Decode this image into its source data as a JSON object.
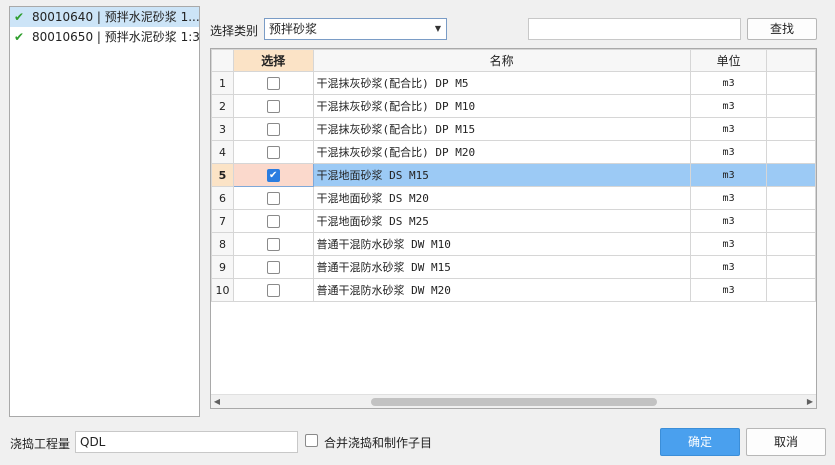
{
  "left_list": {
    "items": [
      {
        "label": "80010640 | 预拌水泥砂浆 1...",
        "selected": true
      },
      {
        "label": "80010650 | 预拌水泥砂浆 1:3",
        "selected": false
      }
    ]
  },
  "filter": {
    "category_label": "选择类别",
    "category_value": "预拌砂浆",
    "search_value": "",
    "search_button": "查找"
  },
  "grid": {
    "headers": {
      "select": "选择",
      "name": "名称",
      "unit": "单位"
    },
    "rows": [
      {
        "no": "1",
        "checked": false,
        "name": "干混抹灰砂浆(配合比) DP M5",
        "unit": "m3"
      },
      {
        "no": "2",
        "checked": false,
        "name": "干混抹灰砂浆(配合比) DP M10",
        "unit": "m3"
      },
      {
        "no": "3",
        "checked": false,
        "name": "干混抹灰砂浆(配合比) DP M15",
        "unit": "m3"
      },
      {
        "no": "4",
        "checked": false,
        "name": "干混抹灰砂浆(配合比) DP M20",
        "unit": "m3"
      },
      {
        "no": "5",
        "checked": true,
        "name": "干混地面砂浆 DS M15",
        "unit": "m3"
      },
      {
        "no": "6",
        "checked": false,
        "name": "干混地面砂浆 DS M20",
        "unit": "m3"
      },
      {
        "no": "7",
        "checked": false,
        "name": "干混地面砂浆 DS M25",
        "unit": "m3"
      },
      {
        "no": "8",
        "checked": false,
        "name": "普通干混防水砂浆 DW M10",
        "unit": "m3"
      },
      {
        "no": "9",
        "checked": false,
        "name": "普通干混防水砂浆 DW M15",
        "unit": "m3"
      },
      {
        "no": "10",
        "checked": false,
        "name": "普通干混防水砂浆 DW M20",
        "unit": "m3"
      }
    ],
    "highlighted_row": 4
  },
  "footer": {
    "quantity_label": "浇捣工程量",
    "quantity_value": "QDL",
    "merge_label": "合并浇捣和制作子目",
    "merge_checked": false,
    "ok_button": "确定",
    "cancel_button": "取消"
  },
  "colors": {
    "accent": "#4aa0ee",
    "row_highlight": "#9ccaf5",
    "header_highlight": "#fbe3c6",
    "check_green": "#2e9e2e"
  }
}
